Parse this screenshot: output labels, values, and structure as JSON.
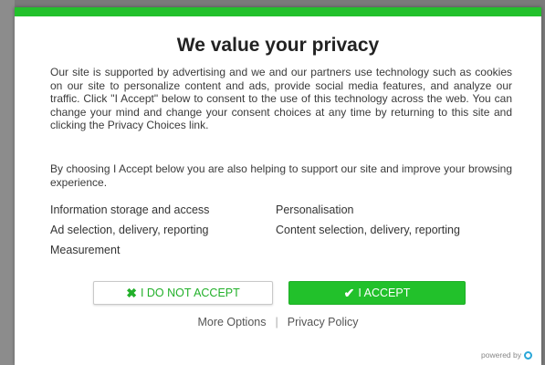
{
  "dialog": {
    "title": "We value your privacy",
    "paragraph1": "Our site is supported by advertising and we and our partners use technology such as cookies on our site to personalize content and ads, provide social media features, and analyze our traffic. Click \"I Accept\" below to consent to the use of this technology across the web. You can change your mind and change your consent choices at any time by returning to this site and clicking the Privacy Choices link.",
    "paragraph2": "By choosing I Accept below you are also helping to support our site and improve your browsing experience.",
    "purposes": [
      "Information storage and access",
      "Personalisation",
      "Ad selection, delivery, reporting",
      "Content selection, delivery, reporting",
      "Measurement"
    ],
    "decline_label": "I DO NOT ACCEPT",
    "accept_label": "I ACCEPT",
    "more_options": "More Options",
    "separator": "|",
    "privacy_policy": "Privacy Policy",
    "powered_by": "powered by"
  },
  "icons": {
    "decline": "x-icon",
    "accept": "checkmark-icon",
    "vendor_logo": "quantcast-logo-icon"
  },
  "colors": {
    "accent": "#22c12b",
    "backdrop": "#7a7a7a"
  }
}
